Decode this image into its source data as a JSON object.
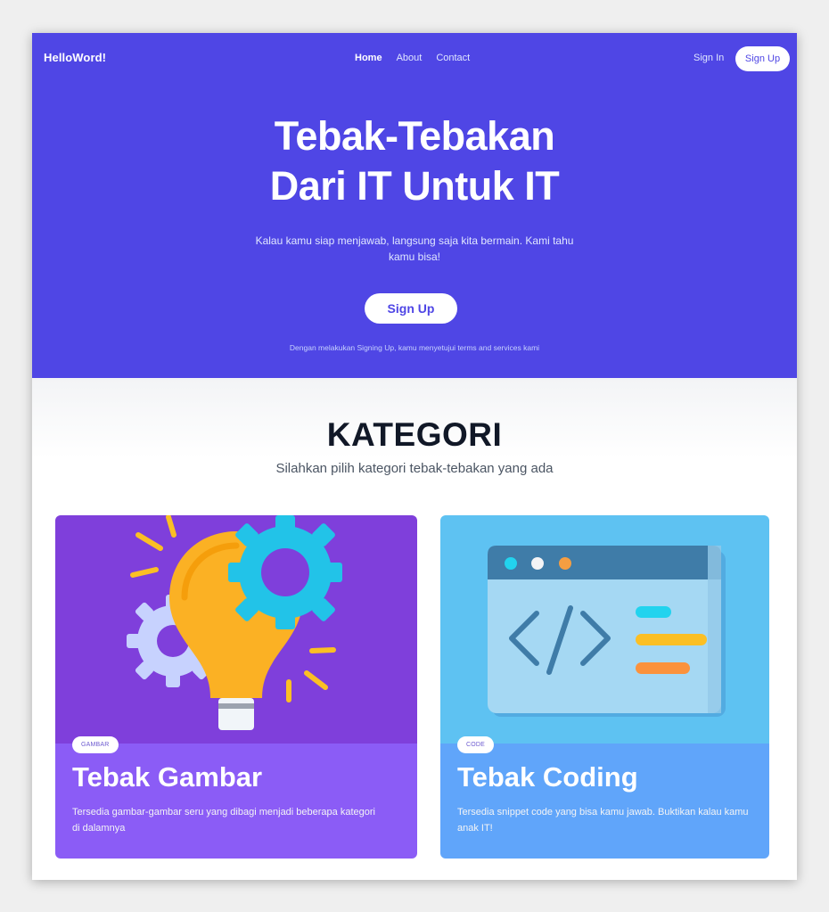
{
  "brand": "HelloWord!",
  "nav": {
    "home": "Home",
    "about": "About",
    "contact": "Contact",
    "sign_in": "Sign In",
    "sign_up": "Sign Up"
  },
  "hero": {
    "title_line1": "Tebak-Tebakan",
    "title_line2": "Dari IT Untuk IT",
    "subtitle": "Kalau kamu siap menjawab, langsung saja kita bermain. Kami tahu kamu bisa!",
    "button": "Sign Up",
    "note": "Dengan melakukan Signing Up, kamu menyetujui terms and services kami",
    "color": "#4f46e5"
  },
  "kategori": {
    "title": "KATEGORI",
    "subtitle": "Silahkan pilih kategori tebak-tebakan yang ada"
  },
  "cards": [
    {
      "badge": "GAMBAR",
      "title": "Tebak Gambar",
      "description": "Tersedia gambar-gambar seru yang dibagi menjadi beberapa kategori di dalamnya",
      "icon": "lightbulb-gears-illustration",
      "color": "#8b5cf6"
    },
    {
      "badge": "CODE",
      "title": "Tebak Coding",
      "description": "Tersedia snippet code yang bisa kamu jawab. Buktikan kalau kamu anak IT!",
      "icon": "code-window-illustration",
      "color": "#60a5fa"
    }
  ]
}
